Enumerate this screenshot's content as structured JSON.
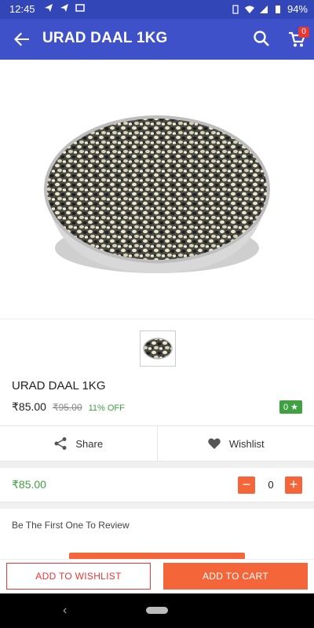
{
  "status_bar": {
    "time": "12:45",
    "battery": "94%"
  },
  "app_bar": {
    "title": "URAD DAAL 1KG",
    "cart_count": "0"
  },
  "product": {
    "name": "URAD DAAL 1KG",
    "price": "₹85.00",
    "mrp": "₹95.00",
    "discount": "11% OFF",
    "rating": "0 ★"
  },
  "actions": {
    "share_label": "Share",
    "wishlist_label": "Wishlist"
  },
  "quantity": {
    "unit_price": "₹85.00",
    "value": "0",
    "minus": "−",
    "plus": "+"
  },
  "reviews": {
    "prompt": "Be The First One To Review"
  },
  "bottom_bar": {
    "add_to_wishlist": "ADD TO WISHLIST",
    "add_to_cart": "ADD TO CART"
  },
  "nav": {
    "back": "‹"
  },
  "colors": {
    "primary": "#3f51c8",
    "accent": "#f4663a",
    "success": "#3fa142",
    "danger": "#e53935"
  },
  "icons": [
    "back-arrow-icon",
    "search-icon",
    "cart-icon",
    "share-icon",
    "heart-icon"
  ]
}
